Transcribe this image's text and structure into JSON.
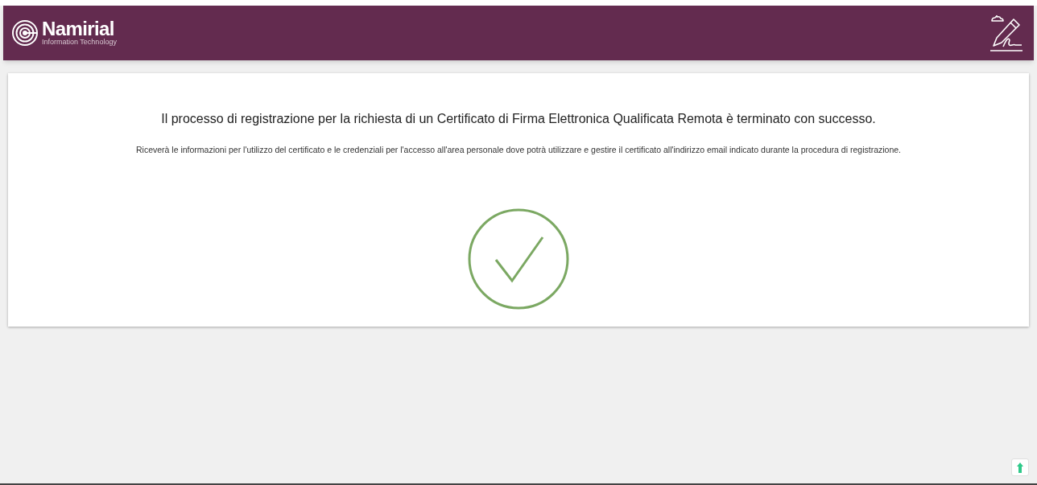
{
  "header": {
    "logo_name": "Namirial",
    "logo_tagline": "Information Technology"
  },
  "message": {
    "title": "Il processo di registrazione per la richiesta di un Certificato di Firma Elettronica Qualificata Remota è terminato con successo.",
    "body": "Riceverà le informazioni per l'utilizzo del certificato e le credenziali per l'accesso all'area personale dove potrà utilizzare e gestire il certificato all'indirizzo email indicato durante la procedura di registrazione."
  }
}
